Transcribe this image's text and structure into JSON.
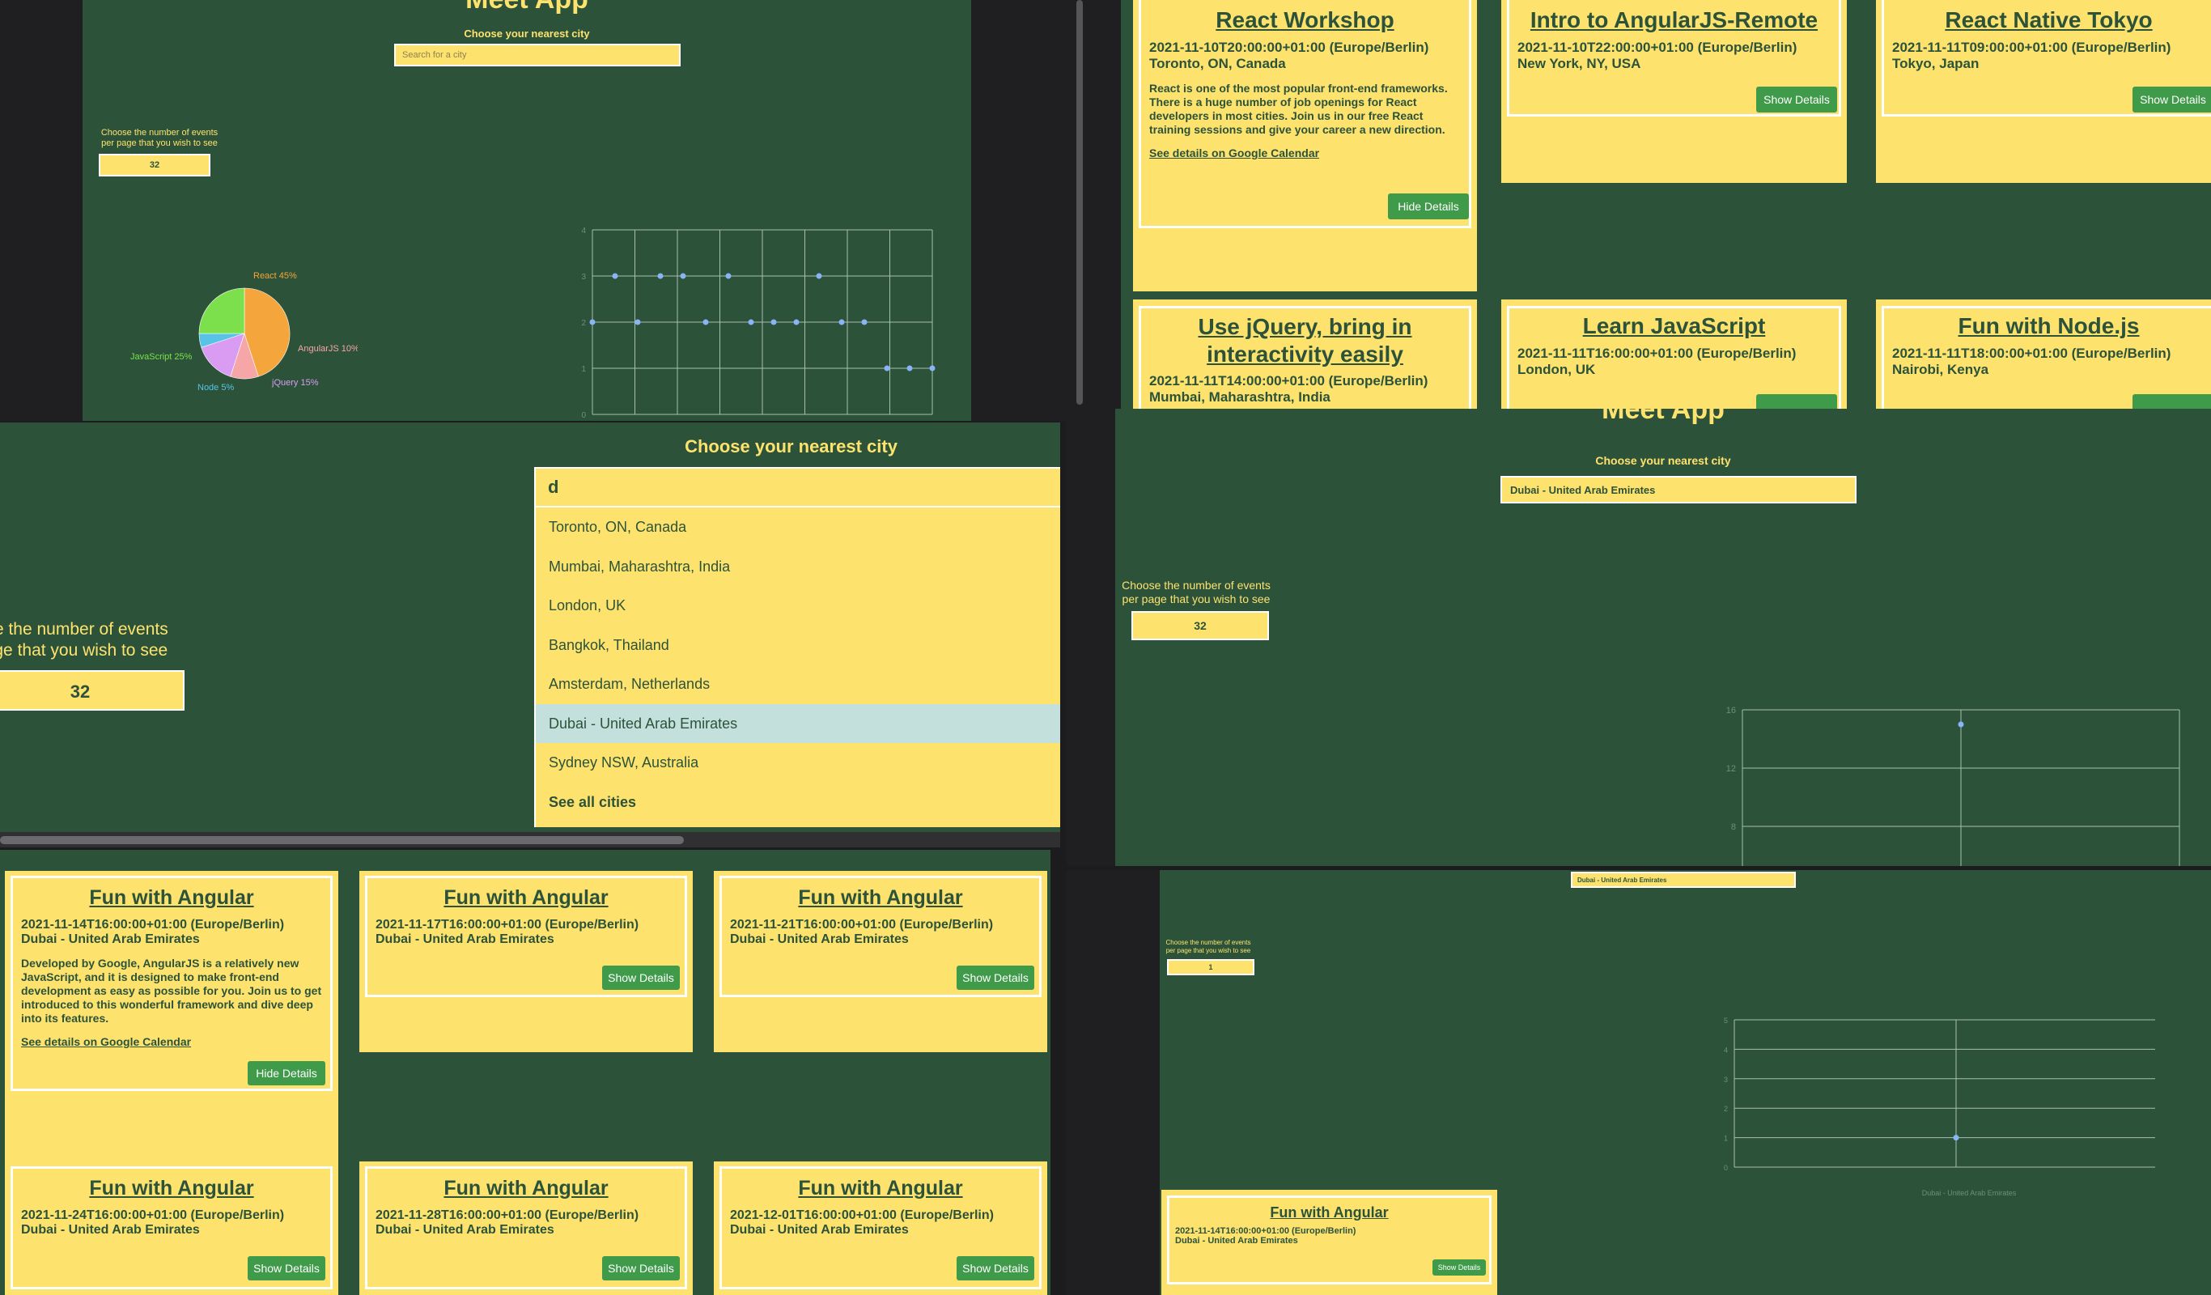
{
  "app_title": "Meet App",
  "city_prompt": "Choose your nearest city",
  "search_placeholder": "Search for a city",
  "number_prompt_line1": "Choose the number of events",
  "number_prompt_line2": "per page that you wish to see",
  "tl": {
    "number_value": "32",
    "pie_labels": {
      "react": "React 45%",
      "angular": "AngularJS 10%",
      "javascript": "JavaScript 25%",
      "node": "Node 5%",
      "jquery": "jQuery 15%"
    },
    "y_ticks": [
      "4",
      "3",
      "2",
      "1",
      "0"
    ]
  },
  "tr": {
    "cards": [
      {
        "title": "React Workshop",
        "date": "2021-11-10T20:00:00+01:00 (Europe/Berlin)",
        "location": "Toronto, ON, Canada",
        "description": "React is one of the most popular front-end frameworks. There is a huge number of job openings for React developers in most cities. Join us in our free React training sessions and give your career a new direction.",
        "gcal": "See details on Google Calendar",
        "button": "Hide Details"
      },
      {
        "title": "Intro to AngularJS-Remote",
        "date": "2021-11-10T22:00:00+01:00 (Europe/Berlin)",
        "location": "New York, NY, USA",
        "button": "Show Details"
      },
      {
        "title": "React Native Tokyo",
        "date": "2021-11-11T09:00:00+01:00 (Europe/Berlin)",
        "location": "Tokyo, Japan",
        "button": "Show Details"
      },
      {
        "title_line1": "Use jQuery, bring in",
        "title_line2": "interactivity easily",
        "date": "2021-11-11T14:00:00+01:00 (Europe/Berlin)",
        "location": "Mumbai, Maharashtra, India"
      },
      {
        "title": "Learn JavaScript",
        "date": "2021-11-11T16:00:00+01:00 (Europe/Berlin)",
        "location": "London, UK"
      },
      {
        "title": "Fun with Node.js",
        "date": "2021-11-11T18:00:00+01:00 (Europe/Berlin)",
        "location": "Nairobi, Kenya"
      }
    ]
  },
  "ml": {
    "search_value": "d",
    "number_value": "32",
    "suggestions": [
      "Toronto, ON, Canada",
      "Mumbai, Maharashtra, India",
      "London, UK",
      "Bangkok, Thailand",
      "Amsterdam, Netherlands",
      "Dubai - United Arab Emirates",
      "Sydney NSW, Australia"
    ],
    "see_all": "See all cities",
    "selected_index": 5
  },
  "mr": {
    "search_value": "Dubai - United Arab Emirates",
    "number_value": "32",
    "y_ticks": [
      "16",
      "12",
      "8"
    ]
  },
  "bl": {
    "cards": [
      {
        "title": "Fun with Angular",
        "date": "2021-11-14T16:00:00+01:00 (Europe/Berlin)",
        "location": "Dubai - United Arab Emirates",
        "description": "Developed by Google, AngularJS is a relatively new JavaScript, and it is designed to make front-end development as easy as possible for you. Join us to get introduced to this wonderful framework and dive deep into its features.",
        "gcal": "See details on Google Calendar",
        "button": "Hide Details"
      },
      {
        "title": "Fun with Angular",
        "date": "2021-11-17T16:00:00+01:00 (Europe/Berlin)",
        "location": "Dubai - United Arab Emirates",
        "button": "Show Details"
      },
      {
        "title": "Fun with Angular",
        "date": "2021-11-21T16:00:00+01:00 (Europe/Berlin)",
        "location": "Dubai - United Arab Emirates",
        "button": "Show Details"
      },
      {
        "title": "Fun with Angular",
        "date": "2021-11-24T16:00:00+01:00 (Europe/Berlin)",
        "location": "Dubai - United Arab Emirates",
        "button": "Show Details"
      },
      {
        "title": "Fun with Angular",
        "date": "2021-11-28T16:00:00+01:00 (Europe/Berlin)",
        "location": "Dubai - United Arab Emirates",
        "button": "Show Details"
      },
      {
        "title": "Fun with Angular",
        "date": "2021-12-01T16:00:00+01:00 (Europe/Berlin)",
        "location": "Dubai - United Arab Emirates",
        "button": "Show Details"
      }
    ]
  },
  "br": {
    "search_value": "Dubai - United Arab Emirates",
    "number_value": "1",
    "y_ticks": [
      "5",
      "4",
      "3",
      "2",
      "1",
      "0"
    ],
    "x_tick": "Dubai - United Arab Emirates",
    "card": {
      "title": "Fun with Angular",
      "date": "2021-11-14T16:00:00+01:00 (Europe/Berlin)",
      "location": "Dubai - United Arab Emirates",
      "button": "Show Details"
    }
  },
  "chart_data": [
    {
      "type": "pie",
      "labels": [
        "React",
        "AngularJS",
        "jQuery",
        "Node",
        "JavaScript"
      ],
      "values": [
        45,
        10,
        15,
        5,
        25
      ],
      "colors": [
        "#f4a53b",
        "#f6a6a6",
        "#d99cf2",
        "#58c3e6",
        "#7be04c"
      ]
    },
    {
      "type": "scatter",
      "ylim": [
        0,
        4
      ],
      "y_ticks": [
        0,
        1,
        2,
        3,
        4
      ],
      "y": [
        2,
        3,
        2,
        3,
        3,
        2,
        3,
        2,
        2,
        2,
        3,
        2,
        2,
        1,
        1,
        1
      ]
    },
    {
      "type": "scatter",
      "y_ticks": [
        8,
        12,
        16
      ],
      "y": [
        15
      ]
    },
    {
      "type": "scatter",
      "ylim": [
        0,
        5
      ],
      "y_ticks": [
        0,
        1,
        2,
        3,
        4,
        5
      ],
      "categories": [
        "Dubai - United Arab Emirates"
      ],
      "y": [
        1
      ]
    }
  ],
  "colors": {
    "background": "#2c533a",
    "accent": "#fde26e",
    "button": "#3f9a4a",
    "highlight": "#c4e0dd",
    "frame": "#1c1c1e"
  }
}
